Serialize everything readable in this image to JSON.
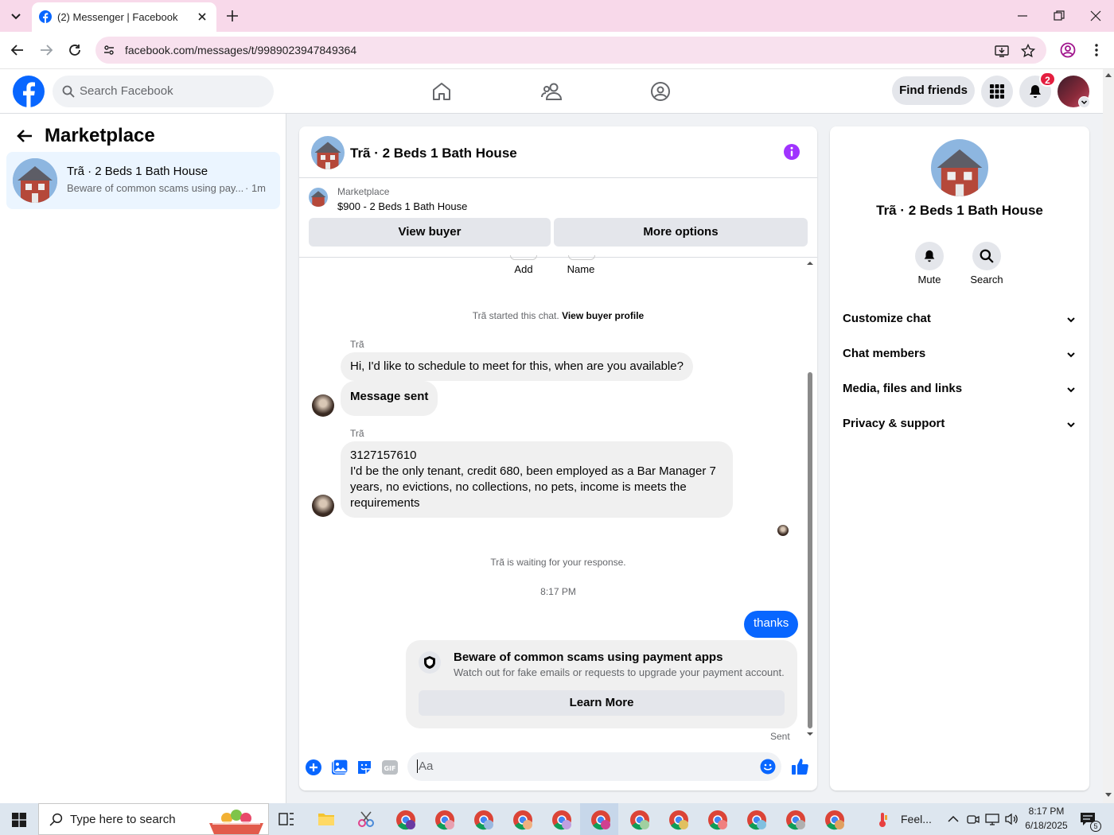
{
  "browser": {
    "tab_title": "(2) Messenger | Facebook",
    "url": "facebook.com/messages/t/9989023947849364"
  },
  "fb_header": {
    "search_placeholder": "Search Facebook",
    "find_friends_label": "Find friends",
    "notification_count": "2"
  },
  "left_panel": {
    "title": "Marketplace",
    "conversation": {
      "name": "Trã · 2 Beds 1 Bath House",
      "preview": "Beware of common scams using pay...",
      "time": "· 1m"
    }
  },
  "chat": {
    "title": "Trã · 2 Beds 1 Bath House",
    "listing_source": "Marketplace",
    "listing_title": "$900 - 2 Beds 1 Bath House",
    "view_buyer_label": "View buyer",
    "more_options_label": "More options",
    "add_label": "Add",
    "name_label": "Name",
    "started_text": "Trã started this chat.",
    "view_profile_link": "View buyer profile",
    "messages": [
      {
        "sender": "Trã",
        "text": "Hi, I'd like to schedule to meet for this, when are you available?"
      },
      {
        "text": "Message sent"
      },
      {
        "sender": "Trã",
        "line1": "3127157610",
        "text": "I'd be the only tenant, credit 680, been employed as a Bar Manager 7 years, no evictions, no collections, no pets, income is meets the requirements"
      }
    ],
    "waiting_text": "Trã is waiting for your response.",
    "timestamp": "8:17 PM",
    "outgoing_message": "thanks",
    "scam_title": "Beware of common scams using payment apps",
    "scam_body": "Watch out for fake emails or requests to upgrade your payment account.",
    "learn_more_label": "Learn More",
    "sent_status": "Sent",
    "composer_placeholder": "Aa"
  },
  "right_panel": {
    "name": "Trã · 2 Beds 1 Bath House",
    "mute_label": "Mute",
    "search_label": "Search",
    "sections": [
      "Customize chat",
      "Chat members",
      "Media, files and links",
      "Privacy & support"
    ]
  },
  "taskbar": {
    "search_placeholder": "Type here to search",
    "weather": "Feel...",
    "time": "8:17 PM",
    "date": "6/18/2025",
    "notif_count": "5"
  },
  "colors": {
    "fb_blue": "#0866ff",
    "messenger_purple": "#a033ff",
    "badge_red": "#e41e3f"
  }
}
